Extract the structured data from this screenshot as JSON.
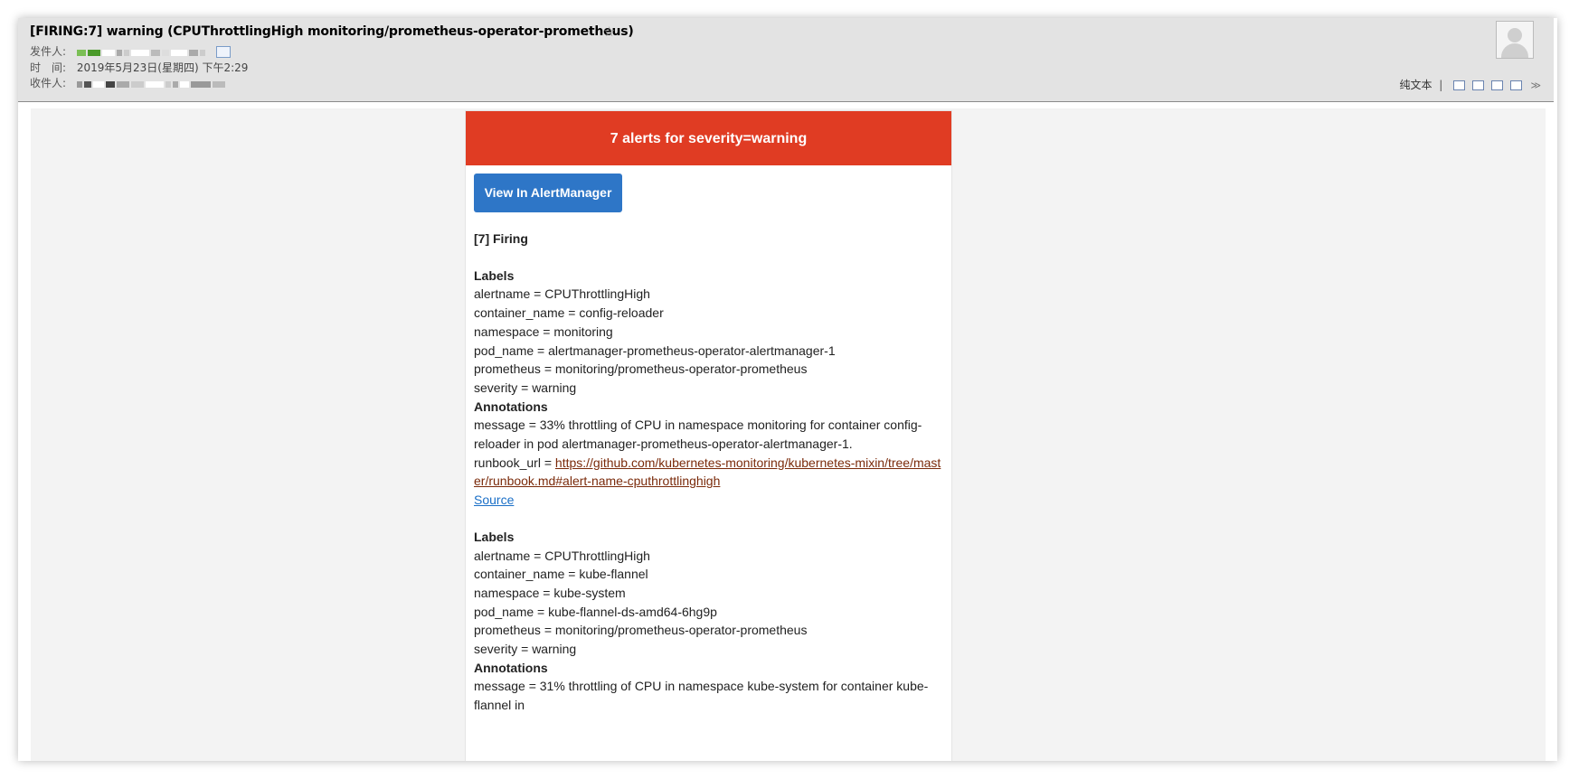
{
  "header": {
    "subject": "[FIRING:7] warning (CPUThrottlingHigh monitoring/prometheus-operator-prometheus)",
    "star_icon": "☆",
    "from_label": "发件人:",
    "time_label": "时　间:",
    "time_value": "2019年5月23日(星期四) 下午2:29",
    "to_label": "收件人:",
    "plain_text_label": "纯文本",
    "toolbar_sep": "|",
    "chevron": "≫"
  },
  "email": {
    "banner": "7 alerts for severity=warning",
    "button": "View In AlertManager",
    "firing": "[7] Firing",
    "alerts": [
      {
        "labels_title": "Labels",
        "alertname": "alertname = CPUThrottlingHigh",
        "container_name": "container_name = config-reloader",
        "namespace": "namespace = monitoring",
        "pod_name": "pod_name = alertmanager-prometheus-operator-alertmanager-1",
        "prometheus": "prometheus = monitoring/prometheus-operator-prometheus",
        "severity": "severity = warning",
        "annotations_title": "Annotations",
        "message": "message = 33% throttling of CPU in namespace monitoring for container config-reloader in pod alertmanager-prometheus-operator-alertmanager-1.",
        "runbook_prefix": "runbook_url = ",
        "runbook_url": "https://github.com/kubernetes-monitoring/kubernetes-mixin/tree/master/runbook.md#alert-name-cputhrottlinghigh",
        "source": "Source"
      },
      {
        "labels_title": "Labels",
        "alertname": "alertname = CPUThrottlingHigh",
        "container_name": "container_name = kube-flannel",
        "namespace": "namespace = kube-system",
        "pod_name": "pod_name = kube-flannel-ds-amd64-6hg9p",
        "prometheus": "prometheus = monitoring/prometheus-operator-prometheus",
        "severity": "severity = warning",
        "annotations_title": "Annotations",
        "message": "message = 31% throttling of CPU in namespace kube-system for container kube-flannel in"
      }
    ]
  },
  "colors": {
    "banner": "#e03c23",
    "button": "#2e76c7",
    "link": "#1a6fc7",
    "runbook_link": "#7a2a0a"
  }
}
